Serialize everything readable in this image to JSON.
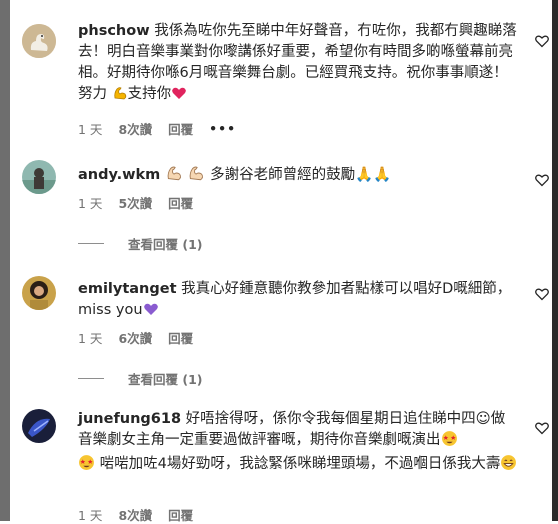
{
  "comments": [
    {
      "username": "phschow",
      "text": "我係為咗你先至睇中年好聲音，冇咗你，我都冇興趣睇落去！明白音樂事業對你嚟講係好重要，希望你有時間多啲喺螢幕前亮相。好期待你喺6月嘅音樂舞台劇。已經買飛支持。祝你事事順遂！努力",
      "text_tail": "支持你",
      "time": "1 天",
      "likes": "8次讚",
      "reply": "回覆",
      "more": "•••"
    },
    {
      "username": "andy.wkm",
      "text": "多謝谷老師曾經的鼓勵🙏🙏",
      "time": "1 天",
      "likes": "5次讚",
      "reply": "回覆",
      "view_replies": "查看回覆 (1)"
    },
    {
      "username": "emilytanget",
      "text": "我真心好鍾意聽你教參加者點樣可以唱好D嘅細節，miss you",
      "time": "1 天",
      "likes": "6次讚",
      "reply": "回覆",
      "view_replies": "查看回覆 (1)"
    },
    {
      "username": "junefung618",
      "text": "好唔捨得呀，係你令我每個星期日追住睇中四☺做音樂劇女主角一定重要過做評審嘅，期待你音樂劇嘅演出",
      "text_mid": "啱啱加咗4場好勁呀，我諗緊係咪睇埋頭場，不過嗰日係我大壽",
      "time": "1 天",
      "likes": "8次讚",
      "reply": "回覆"
    }
  ],
  "colors": {
    "meta": "#737373",
    "heart_emoji": "#e0245e",
    "purple_heart": "#8a5cd0",
    "username": "#262626"
  },
  "icons": [
    "heart-outline-icon",
    "flexed-biceps-icon",
    "red-heart-icon",
    "purple-heart-icon",
    "star-struck-icon",
    "grinning-icon"
  ]
}
